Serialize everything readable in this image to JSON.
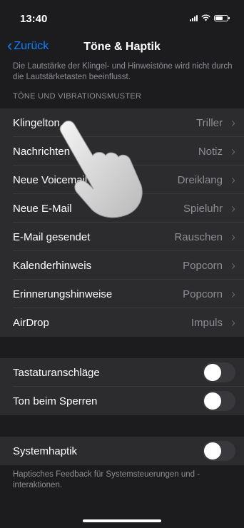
{
  "status": {
    "time": "13:40",
    "battery_level": 0.6
  },
  "nav": {
    "back_label": "Zurück",
    "title": "Töne & Haptik"
  },
  "top_note": "Die Lautstärke der Klingel- und Hinweistöne wird nicht durch die Lautstärketasten beeinflusst.",
  "sounds_section": {
    "header": "TÖNE UND VIBRATIONSMUSTER",
    "items": [
      {
        "label": "Klingelton",
        "value": "Triller"
      },
      {
        "label": "Nachrichten",
        "value": "Notiz"
      },
      {
        "label": "Neue Voicemail",
        "value": "Dreiklang"
      },
      {
        "label": "Neue E-Mail",
        "value": "Spieluhr"
      },
      {
        "label": "E-Mail gesendet",
        "value": "Rauschen"
      },
      {
        "label": "Kalenderhinweis",
        "value": "Popcorn"
      },
      {
        "label": "Erinnerungshinweise",
        "value": "Popcorn"
      },
      {
        "label": "AirDrop",
        "value": "Impuls"
      }
    ]
  },
  "toggles_section": {
    "items": [
      {
        "label": "Tastaturanschläge",
        "on": false
      },
      {
        "label": "Ton beim Sperren",
        "on": false
      }
    ]
  },
  "haptics_section": {
    "items": [
      {
        "label": "Systemhaptik",
        "on": false
      }
    ],
    "footer": "Haptisches Feedback für Systemsteuerungen und -interaktionen."
  },
  "colors": {
    "accent": "#0a84ff",
    "background": "#1c1c1e",
    "cell": "#2c2c2e",
    "secondary_text": "#8e8e93"
  },
  "icons": {
    "back": "chevron-left-icon",
    "disclosure": "chevron-right-icon",
    "signal": "cellular-signal-icon",
    "wifi": "wifi-icon",
    "battery": "battery-icon",
    "hand": "pointing-hand-icon"
  }
}
